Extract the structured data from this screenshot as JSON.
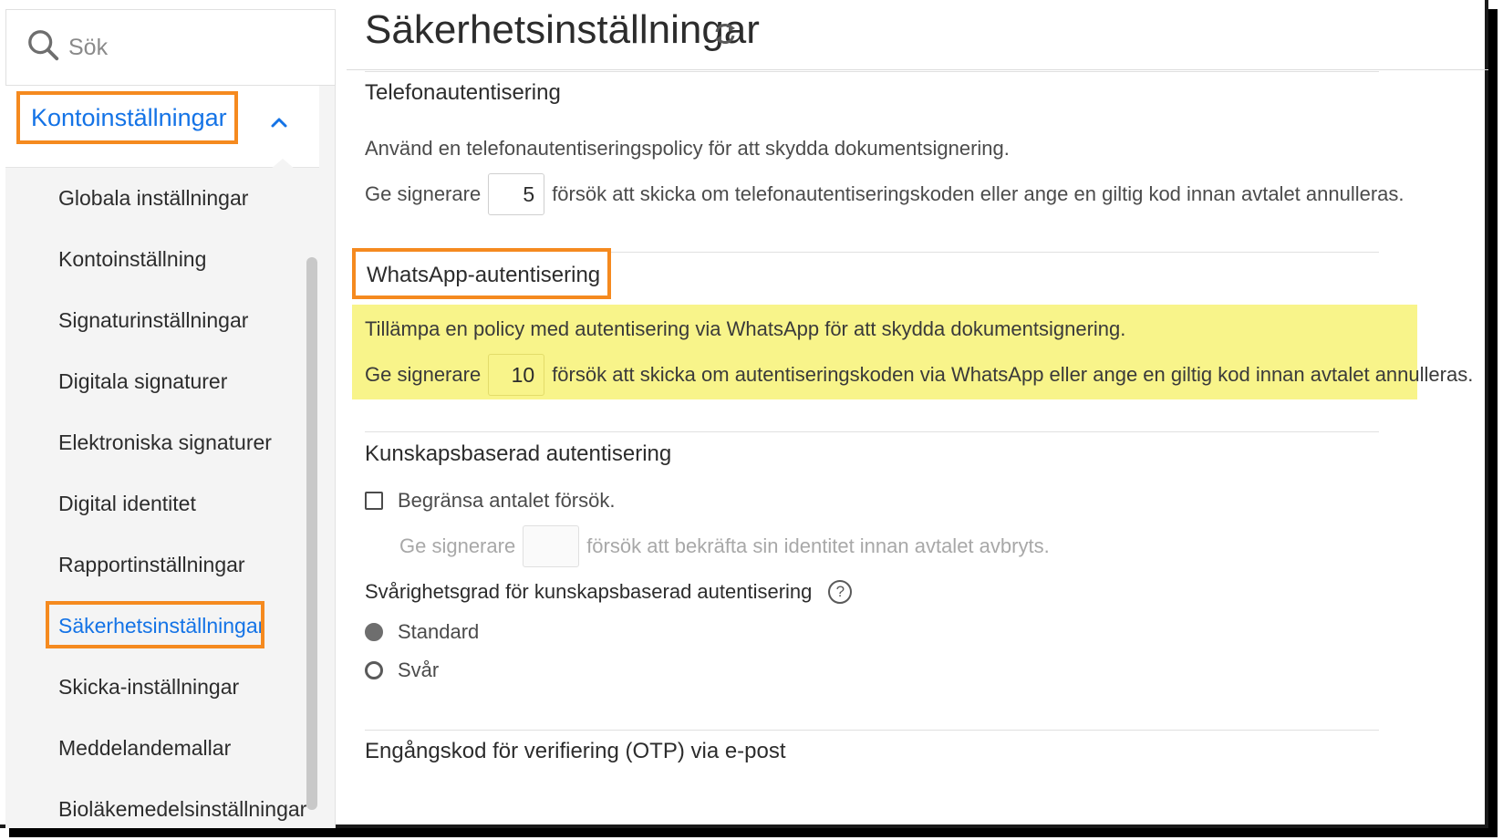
{
  "search": {
    "label": "Sök"
  },
  "sidebar": {
    "section_title": "Kontoinställningar",
    "items": [
      {
        "label": "Globala inställningar",
        "active": false
      },
      {
        "label": "Kontoinställning",
        "active": false
      },
      {
        "label": "Signaturinställningar",
        "active": false
      },
      {
        "label": "Digitala signaturer",
        "active": false
      },
      {
        "label": "Elektroniska signaturer",
        "active": false
      },
      {
        "label": "Digital identitet",
        "active": false
      },
      {
        "label": "Rapportinställningar",
        "active": false
      },
      {
        "label": "Säkerhetsinställningar",
        "active": true
      },
      {
        "label": "Skicka-inställningar",
        "active": false
      },
      {
        "label": "Meddelandemallar",
        "active": false
      },
      {
        "label": "Bioläkemedelsinställningar",
        "active": false
      }
    ]
  },
  "main": {
    "title": "Säkerhetsinställningar",
    "phone_auth": {
      "heading": "Telefonautentisering",
      "description": "Använd en telefonautentiseringspolicy för att skydda dokumentsignering.",
      "prefix": "Ge signerare",
      "value": "5",
      "suffix": "försök att skicka om telefonautentiseringskoden eller ange en giltig kod innan avtalet annulleras."
    },
    "whatsapp_auth": {
      "heading": "WhatsApp-autentisering",
      "description": "Tillämpa en policy med autentisering via WhatsApp för att skydda dokumentsignering.",
      "prefix": "Ge signerare",
      "value": "10",
      "suffix": "försök att skicka om autentiseringskoden via WhatsApp eller ange en giltig kod innan avtalet annulleras."
    },
    "kba": {
      "heading": "Kunskapsbaserad autentisering",
      "checkbox_label": "Begränsa antalet försök.",
      "checkbox_checked": false,
      "prefix": "Ge signerare",
      "value": "",
      "suffix": "försök att bekräfta sin identitet innan avtalet avbryts.",
      "difficulty_heading": "Svårighetsgrad för kunskapsbaserad autentisering",
      "help_glyph": "?",
      "options": [
        {
          "label": "Standard",
          "selected": true
        },
        {
          "label": "Svår",
          "selected": false
        }
      ]
    },
    "otp_email": {
      "heading": "Engångskod för verifiering (OTP) via e-post"
    }
  },
  "colors": {
    "accent": "#1473e6",
    "highlight_border": "#f58a1f",
    "highlight_fill": "#f8f48a"
  }
}
